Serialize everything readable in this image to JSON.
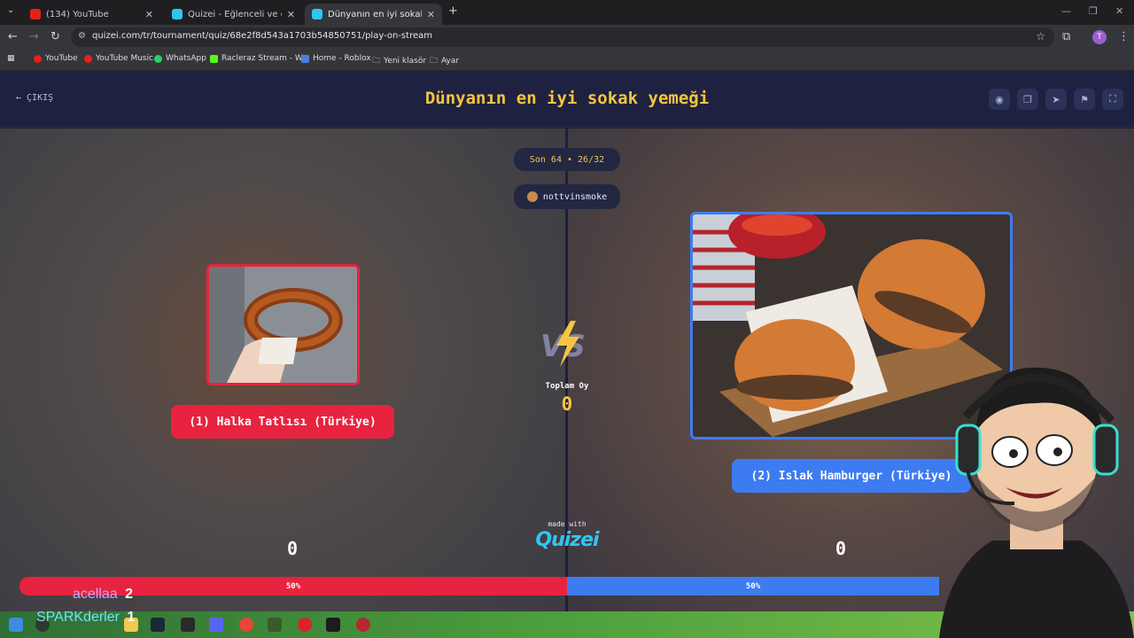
{
  "browser": {
    "tabs": [
      {
        "label": "(134) YouTube",
        "active": false
      },
      {
        "label": "Quizei - Eğlenceli ve etkileşimli",
        "active": false
      },
      {
        "label": "Dünyanın en iyi sokak yemeği",
        "active": true
      }
    ],
    "url": "quizei.com/tr/tournament/quiz/68e2f8d543a1703b54850751/play-on-stream",
    "bookmarks": [
      "YouTube",
      "YouTube Music",
      "WhatsApp",
      "Racleraz Stream - W...",
      "Home - Roblox",
      "Yeni klasör",
      "Ayar"
    ],
    "profile_initial": "T"
  },
  "header": {
    "exit_label": "ÇIKIŞ",
    "title": "Dünyanın en iyi sokak yemeği",
    "icons": [
      "eye-icon",
      "copy-icon",
      "send-icon",
      "flag-icon",
      "fullscreen-icon"
    ]
  },
  "match": {
    "round": "Son 64 • 26/32",
    "username": "nottvinsmoke",
    "total_label": "Toplam Oy",
    "total_votes": "0",
    "left": {
      "label": "(1) Halka Tatlısı (Türkiye)",
      "score": "0",
      "percent_label": "50%"
    },
    "right": {
      "label": "(2) Islak Hamburger (Türkiye)",
      "score": "0",
      "percent_label": "50%"
    }
  },
  "branding": {
    "made_with": "made with",
    "name": "Quizei"
  },
  "overlay": {
    "chat": [
      {
        "name": "acellaa",
        "count": "2"
      },
      {
        "name": "SPARKderler",
        "count": "1"
      }
    ]
  },
  "colors": {
    "accent_yellow": "#f5c542",
    "left": "#e8233f",
    "right": "#3d7cf0",
    "header": "#1e2140"
  }
}
